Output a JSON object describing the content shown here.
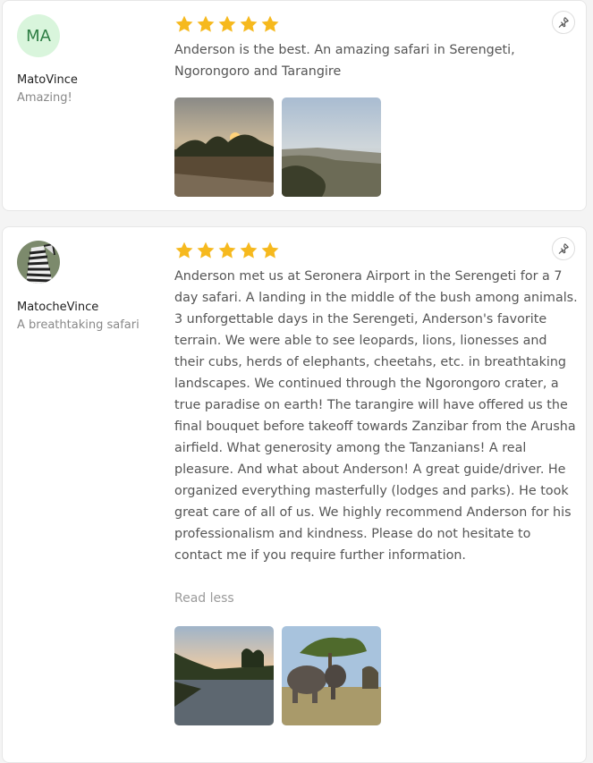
{
  "colors": {
    "star": "#f6b91e",
    "avatar_bg": "#d9f5dc",
    "avatar_text": "#2e7d44"
  },
  "reviews": [
    {
      "avatar_initials": "MA",
      "name": "MatoVince",
      "title": "Amazing!",
      "rating": 5,
      "text": "Anderson is the best. An amazing safari in Serengeti, Ngorongoro and Tarangire",
      "photos": [
        "savanna-sunset-photo",
        "crater-view-photo"
      ]
    },
    {
      "avatar_icon": "zebra-avatar",
      "name": "MatocheVince",
      "title": "A breathtaking safari",
      "rating": 5,
      "text": "Anderson met us at Seronera Airport in the Serengeti for a 7 day safari. A landing in the middle of the bush among animals. 3 unforgettable days in the Serengeti, Anderson's favorite terrain. We were able to see leopards, lions, lionesses and their cubs, herds of elephants, cheetahs, etc. in breathtaking landscapes. We continued through the Ngorongoro crater, a true paradise on earth! The tarangire will have offered us the final bouquet before takeoff towards Zanzibar from the Arusha airfield. What generosity among the Tanzanians! A real pleasure. And what about Anderson! A great guide/driver. He organized everything masterfully (lodges and parks). He took great care of all of us. We highly recommend Anderson for his professionalism and kindness. Please do not hesitate to contact me if you require further information.",
      "read_less_label": "Read less",
      "photos": [
        "river-photo",
        "elephants-photo"
      ]
    }
  ]
}
